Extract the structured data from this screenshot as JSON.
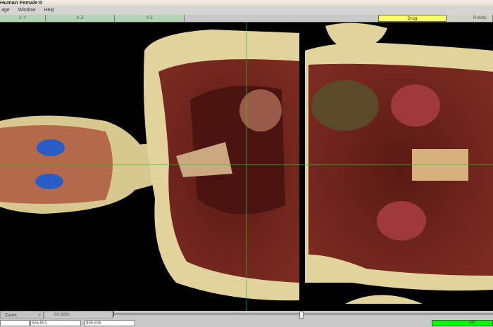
{
  "window": {
    "title": "Human Female:0"
  },
  "menu": [
    "age",
    "Window",
    "Help"
  ],
  "tabs": [
    {
      "label": "X-Y"
    },
    {
      "label": "X-Z"
    },
    {
      "label": "Y-Z"
    }
  ],
  "modes": {
    "drag": "Drag",
    "rotate": "Rotate",
    "active": "Drag"
  },
  "colors": {
    "tab_active": "#b4d4b8",
    "drag_active": "#ffff66",
    "progress": "#00ff00",
    "crosshair": "#22cc22"
  },
  "bottom": {
    "zoom_select": "Zoom",
    "zoom_value": "84.0896",
    "slider_value": 0.5,
    "coord1": "556.902",
    "coord2": "995.838",
    "progress": "100"
  }
}
